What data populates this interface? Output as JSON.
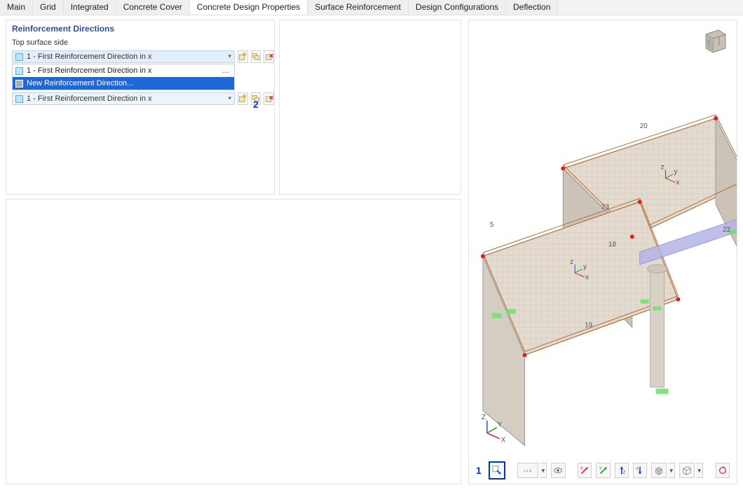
{
  "tabs": {
    "items": [
      "Main",
      "Grid",
      "Integrated",
      "Concrete Cover",
      "Concrete Design Properties",
      "Surface Reinforcement",
      "Design Configurations",
      "Deflection"
    ],
    "active_index": 4
  },
  "left_panel": {
    "title": "Reinforcement Directions",
    "section_label": "Top surface side",
    "combo_value": "1 - First Reinforcement Direction in x",
    "dropdown_items": [
      {
        "label": "1 - First Reinforcement Direction in x",
        "highlight": false,
        "ellipsis": true
      },
      {
        "label": "New Reinforcement Direction...",
        "highlight": true,
        "ellipsis": false
      }
    ],
    "combo_value_2": "1 - First Reinforcement Direction in x",
    "icons": {
      "new_label": "new",
      "copy_label": "copy",
      "delete_label": "delete"
    }
  },
  "callouts": {
    "one": "1",
    "two": "2"
  },
  "viewport": {
    "edge_labels": {
      "a": "20",
      "b": "23",
      "c": "18",
      "d": "19",
      "e": "5",
      "f": "22"
    },
    "axes": {
      "x": "X",
      "y": "Y",
      "z": "Z"
    },
    "axes_small": {
      "x": "x",
      "y": "y",
      "z": "z"
    },
    "toolbar": {
      "units": "1 2 3",
      "eye": "view",
      "x": "X",
      "y": "Y",
      "z": "Z",
      "minus_z": "-Z"
    }
  }
}
